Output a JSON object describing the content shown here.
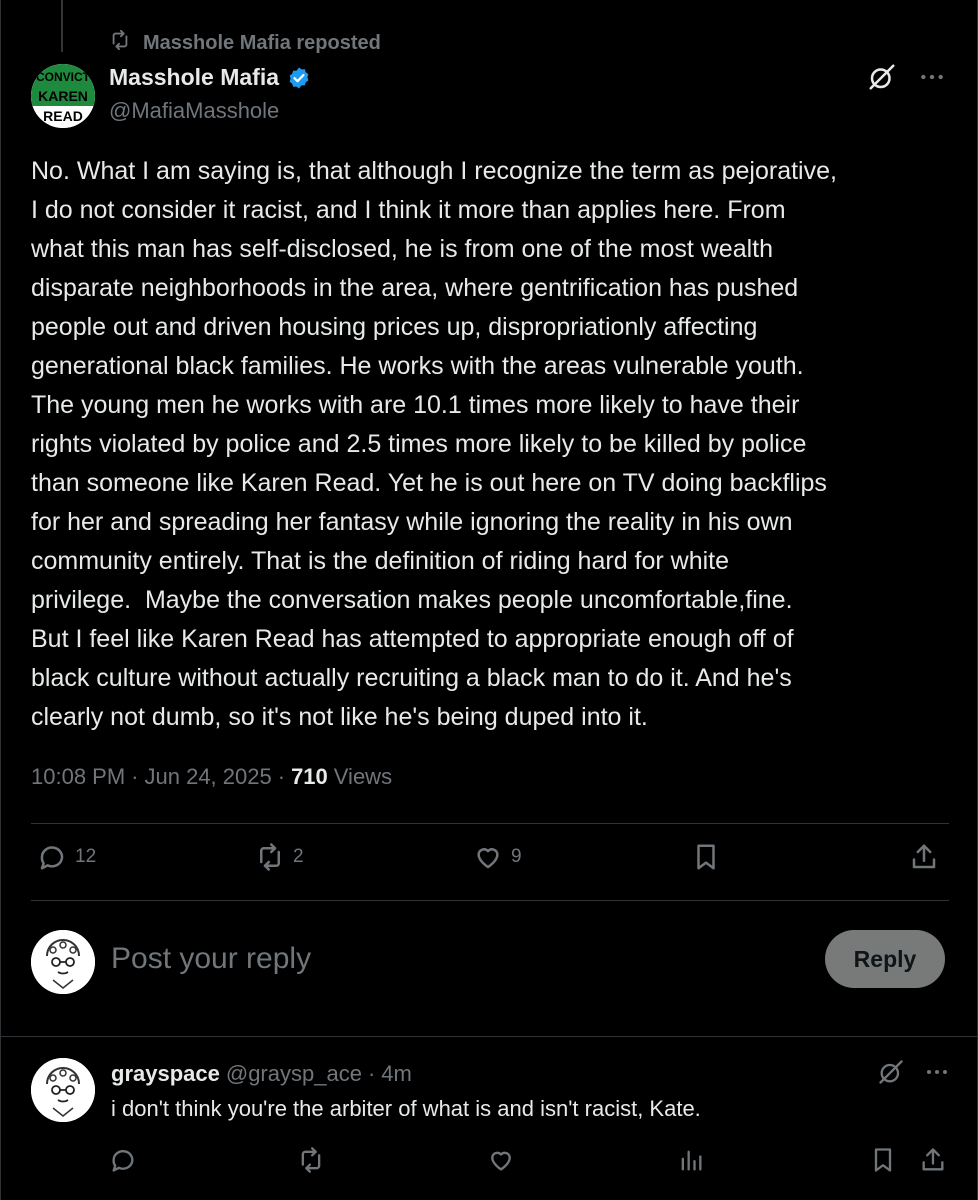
{
  "repost": {
    "label": "Masshole Mafia reposted",
    "icon": "repost-icon"
  },
  "post": {
    "author": {
      "display_name": "Masshole Mafia",
      "handle": "@MafiaMasshole",
      "verified": true,
      "avatar_text": [
        "CONVICT",
        "KAREN",
        "READ"
      ]
    },
    "text": "No. What I am saying is, that although I recognize the term as pejorative,\nI do not consider it racist, and I think it more than applies here. From\nwhat this man has self-disclosed, he is from one of the most wealth\ndisparate neighborhoods in the area, where gentrification has pushed\npeople out and driven housing prices up, dispropriationly affecting\ngenerational black families. He works with the areas vulnerable youth.\nThe young men he works with are 10.1 times more likely to have their\nrights violated by police and 2.5 times more likely to be killed by police\nthan someone like Karen Read. Yet he is out here on TV doing backflips\nfor her and spreading her fantasy while ignoring the reality in his own\ncommunity entirely. That is the definition of riding hard for white\nprivilege.  Maybe the conversation makes people uncomfortable,fine.\nBut I feel like Karen Read has attempted to appropriate enough off of\nblack culture without actually recruiting a black man to do it. And he's\nclearly not dumb, so it's not like he's being duped into it.",
    "time": "10:08 PM",
    "separator": "·",
    "date": "Jun 24, 2025",
    "views_count": "710",
    "views_label": "Views",
    "stats": {
      "replies": "12",
      "reposts": "2",
      "likes": "9"
    }
  },
  "composer": {
    "placeholder": "Post your reply",
    "button_label": "Reply"
  },
  "reply": {
    "display_name": "grayspace",
    "handle": "@graysp_ace",
    "separator": "·",
    "time": "4m",
    "text": "i don't think you're the arbiter of what is and isn't racist, Kate."
  },
  "colors": {
    "background": "#000000",
    "text": "#e7e9ea",
    "muted": "#71767b",
    "verified": "#1d9bf0",
    "divider": "#2f3336",
    "reply_button": "#787a7a"
  }
}
